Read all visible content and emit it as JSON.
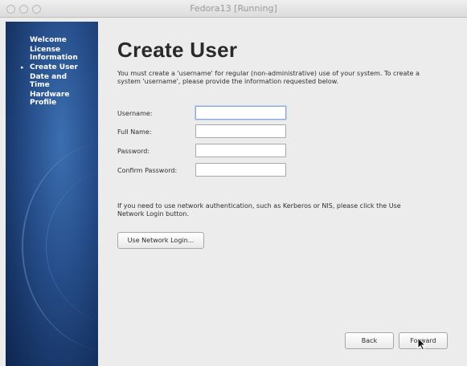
{
  "window": {
    "title": "Fedora13 [Running]"
  },
  "sidebar": {
    "items": [
      {
        "label": "Welcome",
        "current": false
      },
      {
        "label": "License Information",
        "current": false
      },
      {
        "label": "Create User",
        "current": true
      },
      {
        "label": "Date and Time",
        "current": false
      },
      {
        "label": "Hardware Profile",
        "current": false
      }
    ]
  },
  "page": {
    "title": "Create User",
    "intro": "You must create a 'username' for regular (non-administrative) use of your system.  To create a system 'username', please provide the information requested below.",
    "form": {
      "username_label": "Username:",
      "username_value": "",
      "fullname_label": "Full Name:",
      "fullname_value": "",
      "password_label": "Password:",
      "password_value": "",
      "confirm_label": "Confirm Password:",
      "confirm_value": ""
    },
    "network_note": "If you need to use network authentication, such as Kerberos or NIS, please click the Use Network Login button.",
    "network_button": "Use Network Login...",
    "back_button": "Back",
    "forward_button": "Forward"
  },
  "colors": {
    "sidebar_dark": "#173566",
    "sidebar_light": "#3c6fb0",
    "background": "#ececec"
  }
}
